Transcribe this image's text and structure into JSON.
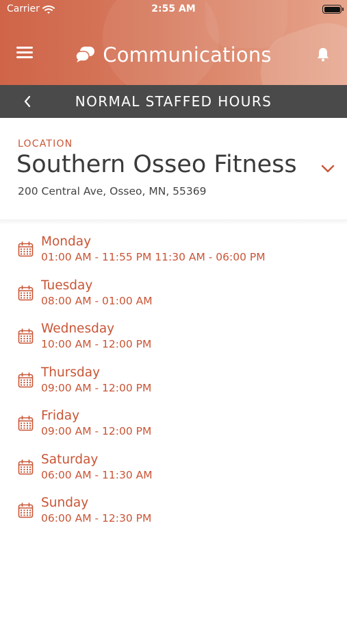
{
  "status_bar": {
    "carrier": "Carrier",
    "time": "2:55 AM",
    "wifi_icon": "wifi-icon",
    "battery_icon": "battery-icon"
  },
  "header": {
    "title": "Communications",
    "menu_icon": "hamburger-menu-icon",
    "title_icon": "chat-bubbles-icon",
    "notification_icon": "bell-icon",
    "gradient_colors": [
      "#cf6448",
      "#e6a58c"
    ]
  },
  "subheader": {
    "title": "NORMAL STAFFED HOURS",
    "back_icon": "chevron-left-icon",
    "background": "#4a4a4a"
  },
  "location": {
    "label": "LOCATION",
    "name": "Southern Osseo Fitness",
    "address": "200 Central Ave, Osseo, MN, 55369",
    "dropdown_icon": "chevron-down-icon"
  },
  "hours": [
    {
      "day": "Monday",
      "hours": "01:00 AM - 11:55 PM 11:30 AM - 06:00 PM"
    },
    {
      "day": "Tuesday",
      "hours": "08:00 AM - 01:00 AM"
    },
    {
      "day": "Wednesday",
      "hours": "10:00 AM - 12:00 PM"
    },
    {
      "day": "Thursday",
      "hours": "09:00 AM - 12:00 PM"
    },
    {
      "day": "Friday",
      "hours": "09:00 AM - 12:00 PM"
    },
    {
      "day": "Saturday",
      "hours": "06:00 AM - 11:30 AM"
    },
    {
      "day": "Sunday",
      "hours": "06:00 AM - 12:30 PM"
    }
  ],
  "day_icon": "calendar-icon",
  "colors": {
    "accent": "#c95535",
    "text_dark": "#3a3a3a"
  }
}
